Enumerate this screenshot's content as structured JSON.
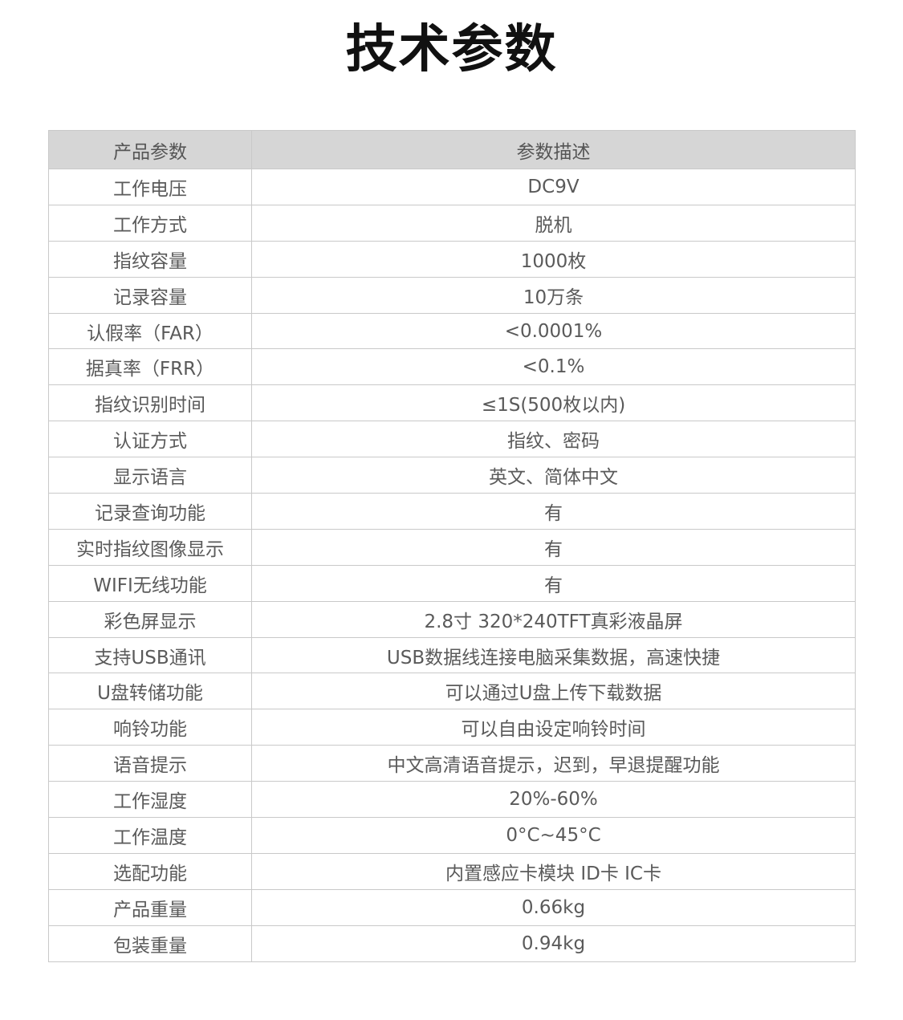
{
  "title": "技术参数",
  "table": {
    "headers": [
      "产品参数",
      "参数描述"
    ],
    "rows": [
      {
        "name": "工作电压",
        "desc": "DC9V"
      },
      {
        "name": "工作方式",
        "desc": "脱机"
      },
      {
        "name": "指纹容量",
        "desc": "1000枚"
      },
      {
        "name": "记录容量",
        "desc": "10万条"
      },
      {
        "name": "认假率（FAR）",
        "desc": "<0.0001%"
      },
      {
        "name": "据真率（FRR）",
        "desc": "<0.1%"
      },
      {
        "name": "指纹识别时间",
        "desc": "≤1S(500枚以内)"
      },
      {
        "name": "认证方式",
        "desc": "指纹、密码"
      },
      {
        "name": "显示语言",
        "desc": "英文、简体中文"
      },
      {
        "name": "记录查询功能",
        "desc": "有"
      },
      {
        "name": "实时指纹图像显示",
        "desc": "有"
      },
      {
        "name": "WIFI无线功能",
        "desc": "有"
      },
      {
        "name": "彩色屏显示",
        "desc": "2.8寸 320*240TFT真彩液晶屏"
      },
      {
        "name": "支持USB通讯",
        "desc": "USB数据线连接电脑采集数据，高速快捷"
      },
      {
        "name": "U盘转储功能",
        "desc": "可以通过U盘上传下载数据"
      },
      {
        "name": "响铃功能",
        "desc": "可以自由设定响铃时间"
      },
      {
        "name": "语音提示",
        "desc": "中文高清语音提示，迟到，早退提醒功能"
      },
      {
        "name": "工作湿度",
        "desc": "20%-60%"
      },
      {
        "name": "工作温度",
        "desc": "0°C~45°C"
      },
      {
        "name": "选配功能",
        "desc": "内置感应卡模块 ID卡 IC卡"
      },
      {
        "name": "产品重量",
        "desc": "0.66kg"
      },
      {
        "name": "包装重量",
        "desc": "0.94kg"
      }
    ]
  }
}
